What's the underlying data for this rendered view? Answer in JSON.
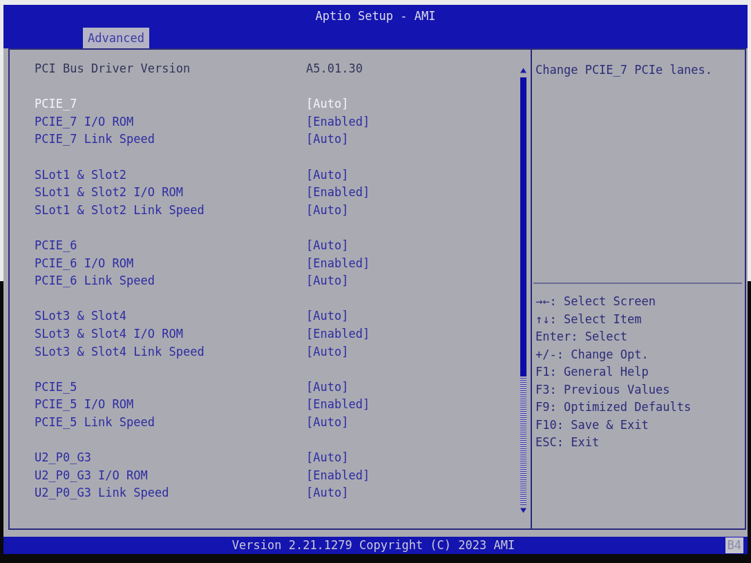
{
  "header": {
    "title": "Aptio Setup - AMI",
    "tabs": [
      {
        "label": "Advanced",
        "selected": true
      }
    ]
  },
  "info": {
    "label": "PCI Bus Driver Version",
    "value": "A5.01.30"
  },
  "groups": [
    {
      "items": [
        {
          "label": "PCIE_7",
          "value": "[Auto]",
          "selected": true
        },
        {
          "label": "PCIE_7 I/O ROM",
          "value": "[Enabled]",
          "selected": false
        },
        {
          "label": "PCIE_7 Link Speed",
          "value": "[Auto]",
          "selected": false
        }
      ]
    },
    {
      "items": [
        {
          "label": "SLot1 & Slot2",
          "value": "[Auto]",
          "selected": false
        },
        {
          "label": "SLot1 & Slot2 I/O ROM",
          "value": "[Enabled]",
          "selected": false
        },
        {
          "label": "SLot1 & Slot2 Link Speed",
          "value": "[Auto]",
          "selected": false
        }
      ]
    },
    {
      "items": [
        {
          "label": "PCIE_6",
          "value": "[Auto]",
          "selected": false
        },
        {
          "label": "PCIE_6 I/O ROM",
          "value": "[Enabled]",
          "selected": false
        },
        {
          "label": "PCIE_6 Link Speed",
          "value": "[Auto]",
          "selected": false
        }
      ]
    },
    {
      "items": [
        {
          "label": "SLot3 & Slot4",
          "value": "[Auto]",
          "selected": false
        },
        {
          "label": "SLot3 & Slot4 I/O ROM",
          "value": "[Enabled]",
          "selected": false
        },
        {
          "label": "SLot3 & Slot4 Link Speed",
          "value": "[Auto]",
          "selected": false
        }
      ]
    },
    {
      "items": [
        {
          "label": "PCIE_5",
          "value": "[Auto]",
          "selected": false
        },
        {
          "label": "PCIE_5 I/O ROM",
          "value": "[Enabled]",
          "selected": false
        },
        {
          "label": "PCIE_5 Link Speed",
          "value": "[Auto]",
          "selected": false
        }
      ]
    },
    {
      "items": [
        {
          "label": "U2_P0_G3",
          "value": "[Auto]",
          "selected": false
        },
        {
          "label": "U2_P0_G3 I/O ROM",
          "value": "[Enabled]",
          "selected": false
        },
        {
          "label": "U2_P0_G3 Link Speed",
          "value": "[Auto]",
          "selected": false
        }
      ]
    }
  ],
  "help": {
    "description": "Change PCIE_7 PCIe lanes.",
    "keys": [
      "→←: Select Screen",
      "↑↓: Select Item",
      "Enter: Select",
      "+/-: Change Opt.",
      "F1: General Help",
      "F3: Previous Values",
      "F9: Optimized Defaults",
      "F10: Save & Exit",
      "ESC: Exit"
    ]
  },
  "footer": {
    "version": "Version 2.21.1279 Copyright (C) 2023 AMI",
    "code": "B4"
  }
}
